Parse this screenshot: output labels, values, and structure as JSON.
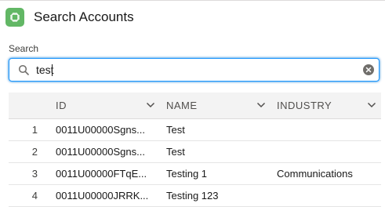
{
  "header": {
    "title": "Search Accounts",
    "icon": "app-icon"
  },
  "search": {
    "label": "Search",
    "value": "test"
  },
  "table": {
    "columns": [
      "ID",
      "NAME",
      "INDUSTRY"
    ],
    "rows": [
      {
        "num": "1",
        "id": "0011U00000Sgns...",
        "name": "Test",
        "industry": ""
      },
      {
        "num": "2",
        "id": "0011U00000Sgns...",
        "name": "Test",
        "industry": ""
      },
      {
        "num": "3",
        "id": "0011U00000FTqE...",
        "name": "Testing 1",
        "industry": "Communications"
      },
      {
        "num": "4",
        "id": "0011U00000JRRK...",
        "name": "Testing 123",
        "industry": ""
      }
    ]
  },
  "colors": {
    "accent": "#1b96ff",
    "icon_bg": "#62b765",
    "header_bg": "#f3f3f3"
  }
}
